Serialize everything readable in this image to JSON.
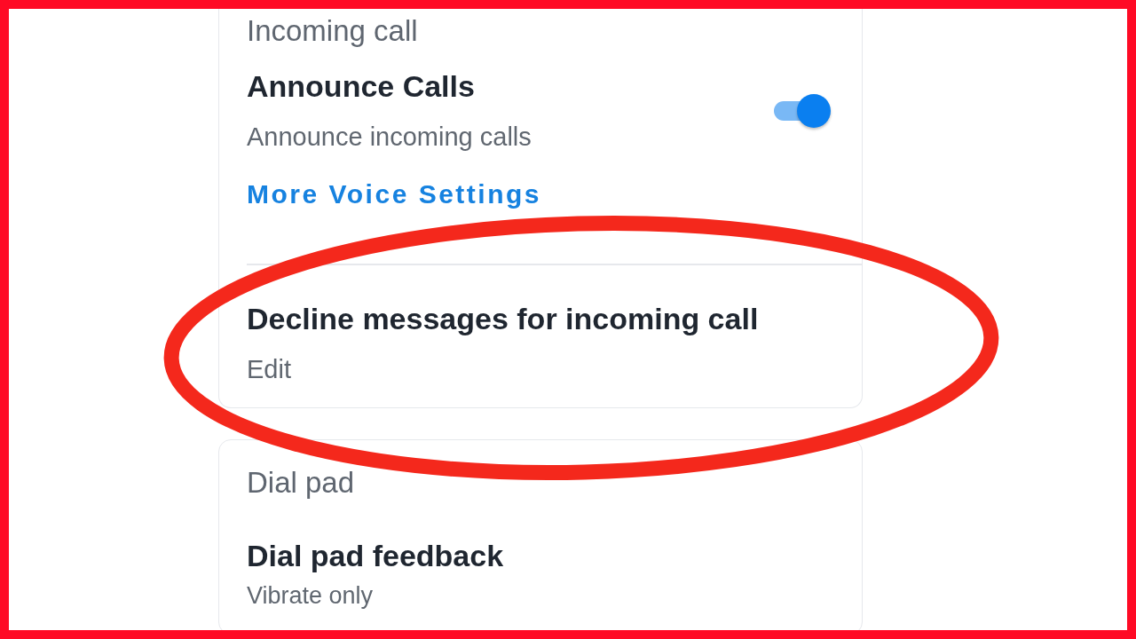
{
  "sections": [
    {
      "header": "Incoming call",
      "items": [
        {
          "kind": "toggle",
          "title": "Announce Calls",
          "subtitle": "Announce incoming calls",
          "on": true
        },
        {
          "kind": "link",
          "label": "More Voice Settings"
        },
        {
          "kind": "divider"
        },
        {
          "kind": "nav",
          "title": "Decline messages for incoming call",
          "subtitle": "Edit"
        }
      ]
    },
    {
      "header": "Dial pad",
      "items": [
        {
          "kind": "nav",
          "title": "Dial pad feedback",
          "subtitle": "Vibrate only"
        }
      ]
    }
  ]
}
